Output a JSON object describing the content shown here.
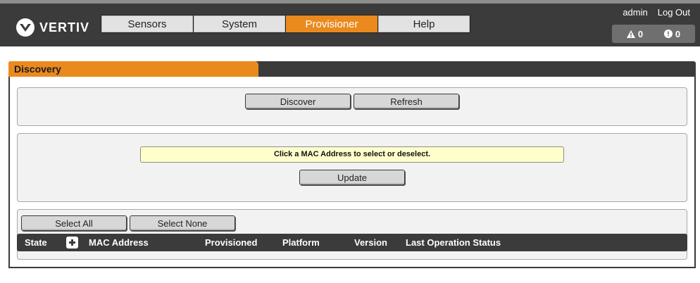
{
  "brand": {
    "name": "VERTIV"
  },
  "nav": {
    "items": [
      {
        "label": "Sensors"
      },
      {
        "label": "System"
      },
      {
        "label": "Provisioner",
        "active": true
      },
      {
        "label": "Help"
      }
    ]
  },
  "user": {
    "name": "admin",
    "logout": "Log Out"
  },
  "alerts": {
    "warning_count": "0",
    "critical_count": "0"
  },
  "colors": {
    "accent": "#ea8a1e",
    "header": "#3b3b3b",
    "message_bg": "#ffffcc"
  },
  "panel": {
    "title": "Discovery",
    "discover_button": "Discover",
    "refresh_button": "Refresh",
    "message": "Click a MAC Address to select or deselect.",
    "update_button": "Update",
    "select_all_button": "Select All",
    "select_none_button": "Select None"
  },
  "table": {
    "columns": {
      "state": "State",
      "mac": "MAC Address",
      "provisioned": "Provisioned",
      "platform": "Platform",
      "version": "Version",
      "status": "Last Operation Status"
    }
  }
}
